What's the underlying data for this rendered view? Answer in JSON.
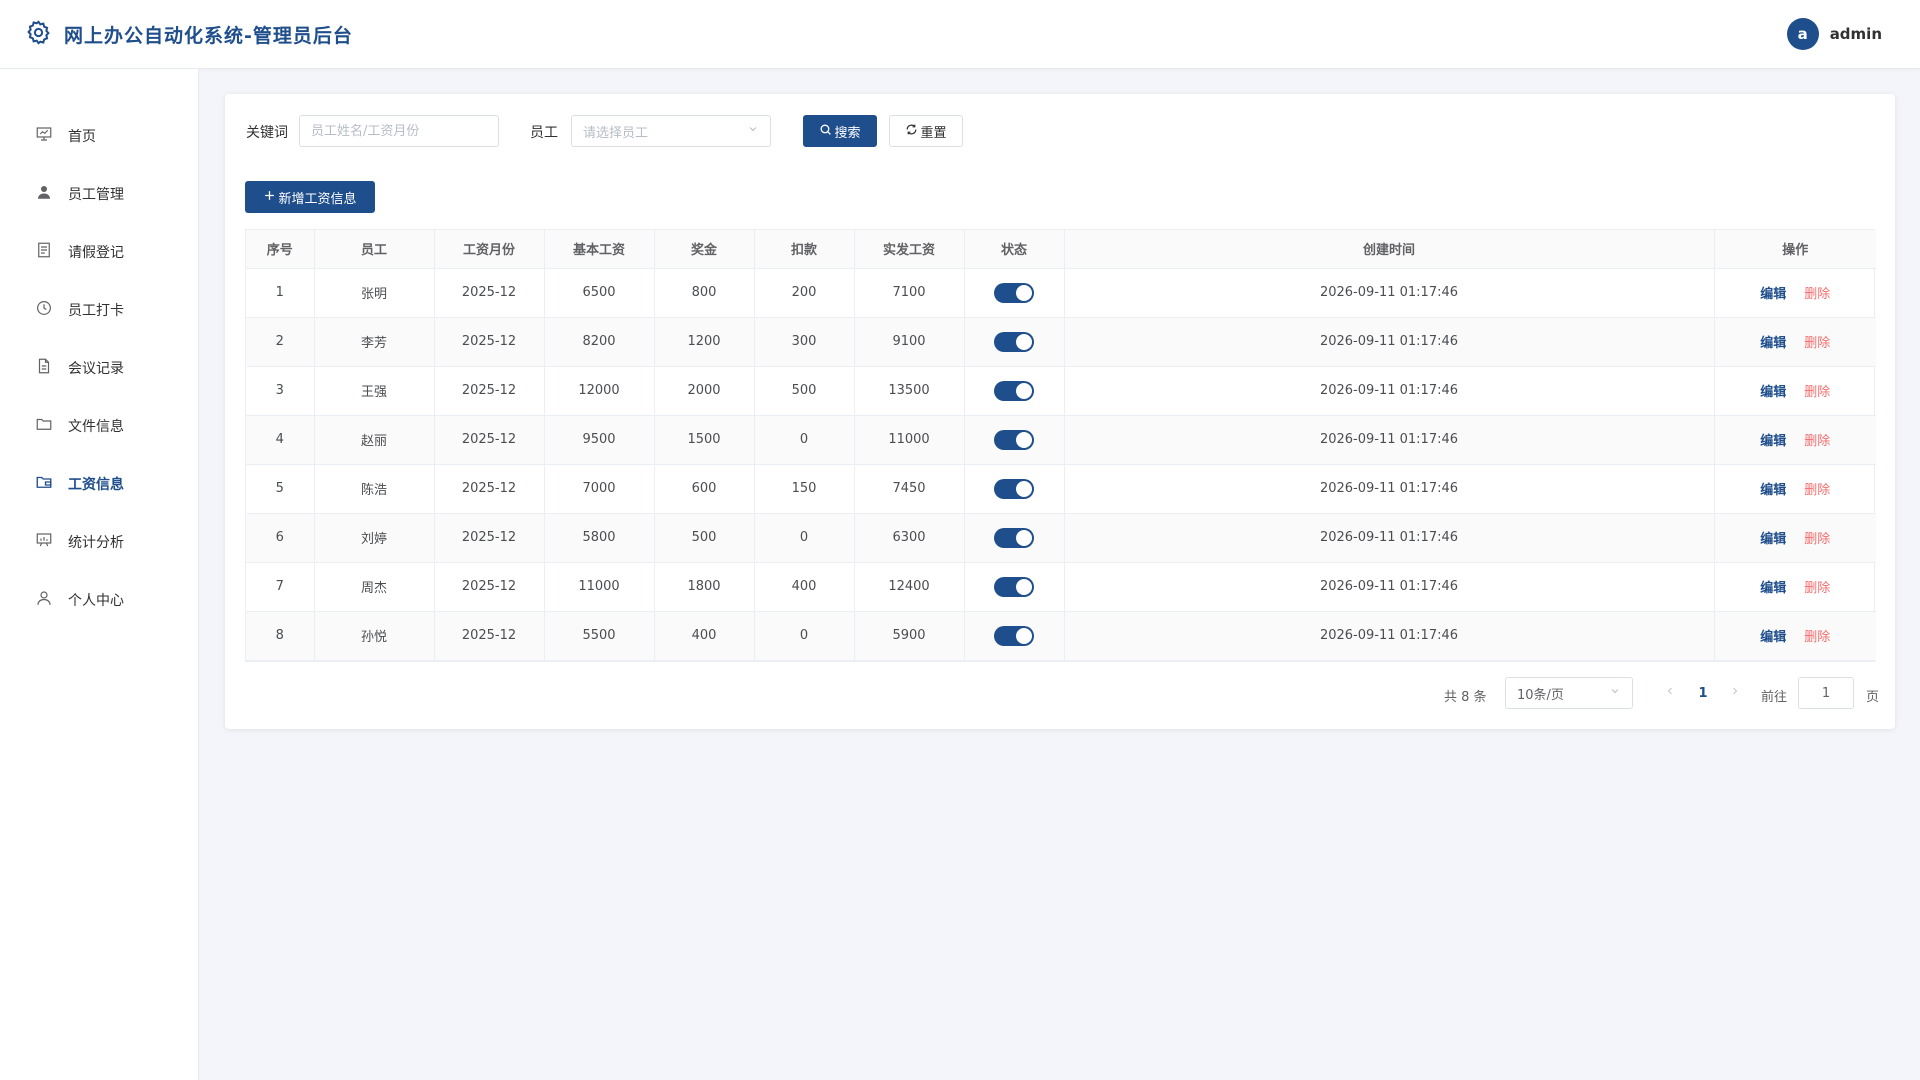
{
  "header": {
    "title": "网上办公自动化系统-管理员后台",
    "avatar_letter": "a",
    "username": "admin"
  },
  "sidebar": {
    "items": [
      {
        "label": "首页",
        "icon": "presentation-board-icon",
        "active": false
      },
      {
        "label": "员工管理",
        "icon": "user-icon",
        "active": false
      },
      {
        "label": "请假登记",
        "icon": "document-icon",
        "active": false
      },
      {
        "label": "员工打卡",
        "icon": "clock-icon",
        "active": false
      },
      {
        "label": "会议记录",
        "icon": "file-text-icon",
        "active": false
      },
      {
        "label": "文件信息",
        "icon": "folder-icon",
        "active": false
      },
      {
        "label": "工资信息",
        "icon": "wallet-folder-icon",
        "active": true
      },
      {
        "label": "统计分析",
        "icon": "chart-board-icon",
        "active": false
      },
      {
        "label": "个人中心",
        "icon": "user-outline-icon",
        "active": false
      }
    ]
  },
  "filters": {
    "keyword_label": "关键词",
    "keyword_placeholder": "员工姓名/工资月份",
    "keyword_value": "",
    "employee_label": "员工",
    "employee_placeholder": "请选择员工",
    "search_label": "搜索",
    "reset_label": "重置"
  },
  "add_button_label": "新增工资信息",
  "table": {
    "columns": [
      "序号",
      "员工",
      "工资月份",
      "基本工资",
      "奖金",
      "扣款",
      "实发工资",
      "状态",
      "创建时间",
      "操作"
    ],
    "rows": [
      {
        "no": "1",
        "name": "张明",
        "month": "2025-12",
        "base": "6500",
        "bonus": "800",
        "deduct": "200",
        "net": "7100",
        "status": true,
        "created": "2026-09-11 01:17:46"
      },
      {
        "no": "2",
        "name": "李芳",
        "month": "2025-12",
        "base": "8200",
        "bonus": "1200",
        "deduct": "300",
        "net": "9100",
        "status": true,
        "created": "2026-09-11 01:17:46"
      },
      {
        "no": "3",
        "name": "王强",
        "month": "2025-12",
        "base": "12000",
        "bonus": "2000",
        "deduct": "500",
        "net": "13500",
        "status": true,
        "created": "2026-09-11 01:17:46"
      },
      {
        "no": "4",
        "name": "赵丽",
        "month": "2025-12",
        "base": "9500",
        "bonus": "1500",
        "deduct": "0",
        "net": "11000",
        "status": true,
        "created": "2026-09-11 01:17:46"
      },
      {
        "no": "5",
        "name": "陈浩",
        "month": "2025-12",
        "base": "7000",
        "bonus": "600",
        "deduct": "150",
        "net": "7450",
        "status": true,
        "created": "2026-09-11 01:17:46"
      },
      {
        "no": "6",
        "name": "刘婷",
        "month": "2025-12",
        "base": "5800",
        "bonus": "500",
        "deduct": "0",
        "net": "6300",
        "status": true,
        "created": "2026-09-11 01:17:46"
      },
      {
        "no": "7",
        "name": "周杰",
        "month": "2025-12",
        "base": "11000",
        "bonus": "1800",
        "deduct": "400",
        "net": "12400",
        "status": true,
        "created": "2026-09-11 01:17:46"
      },
      {
        "no": "8",
        "name": "孙悦",
        "month": "2025-12",
        "base": "5500",
        "bonus": "400",
        "deduct": "0",
        "net": "5900",
        "status": true,
        "created": "2026-09-11 01:17:46"
      }
    ],
    "edit_label": "编辑",
    "delete_label": "删除"
  },
  "pagination": {
    "total_text": "共 8 条",
    "page_size": "10条/页",
    "current_page": "1",
    "goto_label": "前往",
    "goto_value": "1",
    "page_suffix": "页"
  },
  "colors": {
    "primary": "#1f4e8c",
    "danger": "#f56c6c",
    "background": "#f3f5fa"
  }
}
